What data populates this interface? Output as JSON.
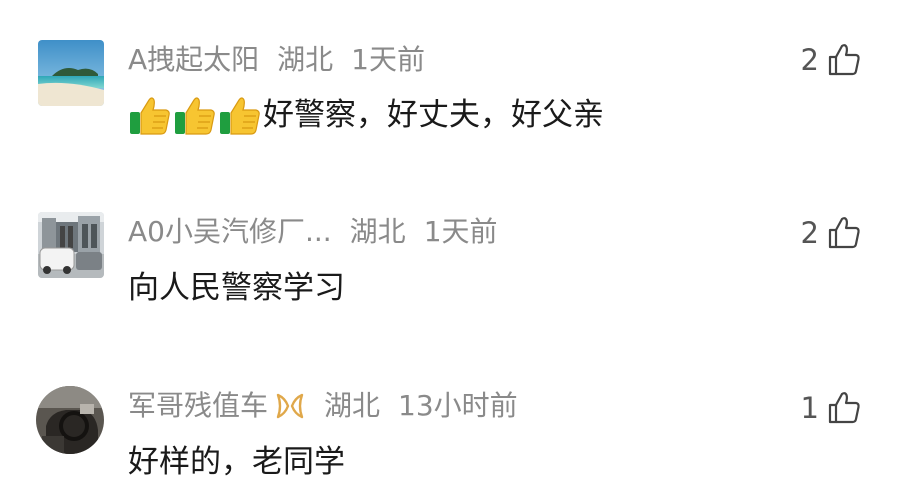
{
  "comments": [
    {
      "username": "A拽起太阳",
      "location": "湖北",
      "time": "1天前",
      "likes": "2",
      "emoji_count": 3,
      "text": "好警察，好丈夫，好父亲"
    },
    {
      "username": "A0小吴汽修厂...",
      "location": "湖北",
      "time": "1天前",
      "likes": "2",
      "text": "向人民警察学习"
    },
    {
      "username": "军哥残值车",
      "location": "湖北",
      "time": "13小时前",
      "likes": "1",
      "text": "好样的，老同学"
    }
  ],
  "icons": {
    "like": "thumbs-up-outline-icon",
    "emoji": "thumbs-up-emoji-icon",
    "badge": "gold-ribbon-badge-icon"
  },
  "colors": {
    "meta_text": "#8a8a8a",
    "body_text": "#1a1a1a",
    "like_text": "#555555",
    "badge": "#e0a84a"
  }
}
